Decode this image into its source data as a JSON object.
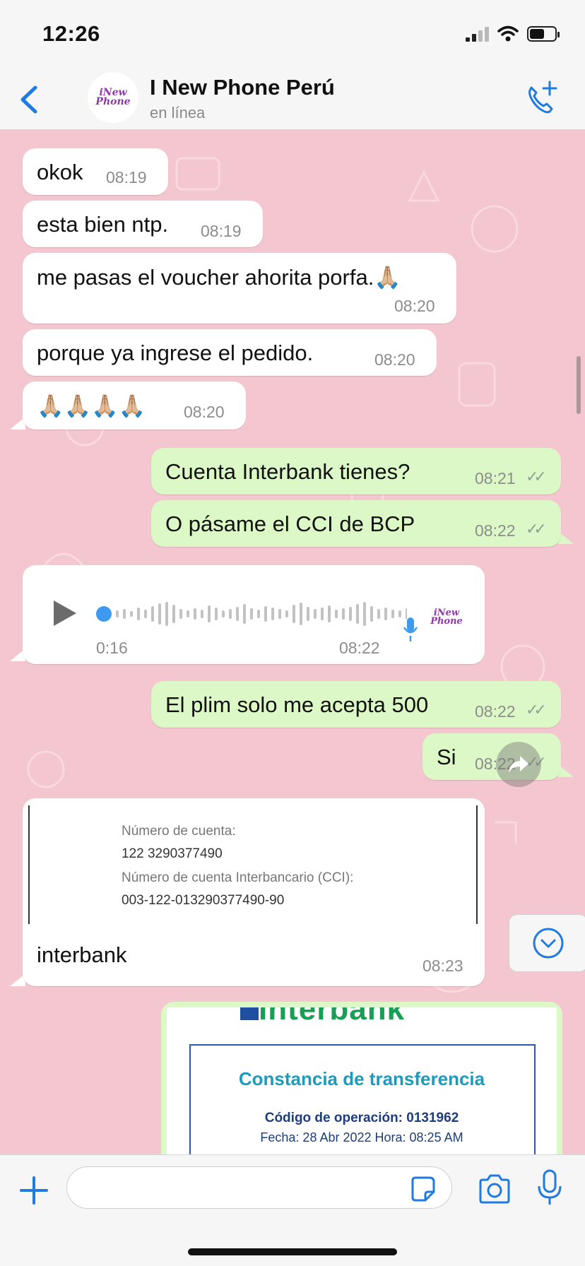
{
  "status_bar": {
    "time": "12:26",
    "battery_level": 0.6
  },
  "header": {
    "avatar_logo_line1": "iNew",
    "avatar_logo_line2": "Phone",
    "contact_name": "I New Phone Perú",
    "contact_status": "en línea",
    "icons": {
      "back": "chevron-left-icon",
      "call": "phone-plus-icon"
    }
  },
  "messages": [
    {
      "dir": "in",
      "text": "okok",
      "time": "08:19"
    },
    {
      "dir": "in",
      "text": "esta bien ntp.",
      "time": "08:19"
    },
    {
      "dir": "in",
      "text": "me pasas el voucher ahorita porfa.🙏🏼",
      "time": "08:20"
    },
    {
      "dir": "in",
      "text": "porque ya ingrese el pedido.",
      "time": "08:20"
    },
    {
      "dir": "in",
      "text": "🙏🏼🙏🏼🙏🏼🙏🏼",
      "time": "08:20"
    },
    {
      "dir": "out",
      "text": "Cuenta Interbank tienes?",
      "time": "08:21",
      "status": "read"
    },
    {
      "dir": "out",
      "text": "O pásame el CCI de BCP",
      "time": "08:22",
      "status": "read"
    },
    {
      "dir": "in",
      "type": "voice",
      "duration": "0:16",
      "time": "08:22",
      "progress": 0.0
    },
    {
      "dir": "out",
      "text": "El plim solo me acepta 500",
      "time": "08:22",
      "status": "read"
    },
    {
      "dir": "out",
      "text": "Si",
      "time": "08:22",
      "status": "read"
    },
    {
      "dir": "in",
      "type": "image",
      "caption": "interbank",
      "time": "08:23",
      "image_text": {
        "account_label": "Número de cuenta:",
        "account_number": "122 3290377490",
        "cci_label": "Número de cuenta Interbancario (CCI):",
        "cci_number": "003-122-013290377490-90"
      }
    },
    {
      "dir": "out",
      "type": "image",
      "image_text": {
        "logo": "Interbank",
        "title": "Constancia de transferencia",
        "operation_code": "Código de operación: 0131962",
        "date_line": "Fecha: 28 Abr 2022      Hora: 08:25 AM"
      }
    }
  ],
  "composer": {
    "value": "",
    "placeholder": ""
  },
  "colors": {
    "chat_background": "#f4c6cf",
    "incoming_bubble": "#ffffff",
    "outgoing_bubble": "#dcf8c6",
    "accent": "#1f7be0",
    "read_ticks": "#8ca59a"
  }
}
